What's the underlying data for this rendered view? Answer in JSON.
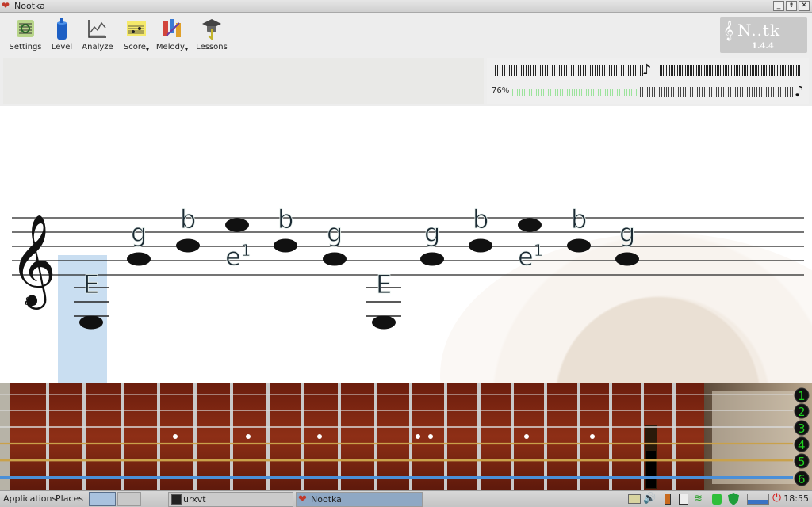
{
  "window": {
    "title": "Nootka"
  },
  "toolbar": {
    "settings": "Settings",
    "level": "Level",
    "analyze": "Analyze",
    "score": "Score",
    "melody": "Melody",
    "lessons": "Lessons"
  },
  "logo": {
    "text": "N..tk",
    "version": "1.4.4"
  },
  "meters": {
    "tuning_percent": "76%",
    "volume_level": 0.76
  },
  "score": {
    "notes": [
      {
        "name": "E",
        "pos": "low"
      },
      {
        "name": "g",
        "pos": "g"
      },
      {
        "name": "b",
        "pos": "b"
      },
      {
        "name": "e1",
        "pos": "e"
      },
      {
        "name": "b",
        "pos": "b"
      },
      {
        "name": "g",
        "pos": "g"
      },
      {
        "name": "E",
        "pos": "low"
      },
      {
        "name": "g",
        "pos": "g"
      },
      {
        "name": "b",
        "pos": "b"
      },
      {
        "name": "e1",
        "pos": "e"
      },
      {
        "name": "b",
        "pos": "b"
      },
      {
        "name": "g",
        "pos": "g"
      }
    ]
  },
  "fretboard": {
    "strings": [
      "1",
      "2",
      "3",
      "4",
      "5",
      "6"
    ]
  },
  "panel": {
    "applications": "Applications",
    "places": "Places",
    "task_terminal": "urxvt",
    "task_app": "Nootka",
    "clock": "18:55"
  },
  "colors": {
    "accent_blue": "#4a8fd8",
    "string_number_green": "#1fd21f",
    "selection_blue": "#b7d3ec"
  }
}
